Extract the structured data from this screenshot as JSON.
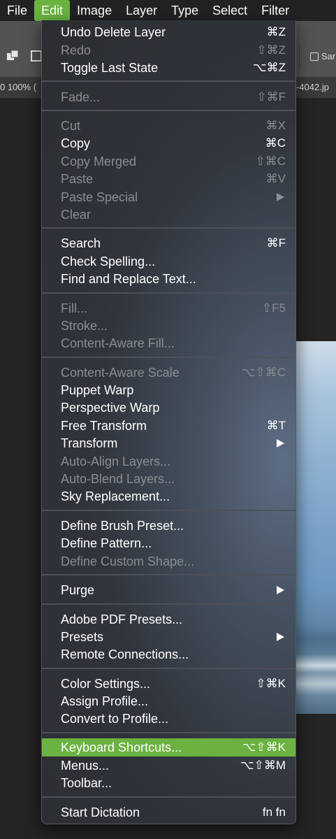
{
  "menubar": {
    "items": [
      {
        "label": "File",
        "active": false
      },
      {
        "label": "Edit",
        "active": true
      },
      {
        "label": "Image",
        "active": false
      },
      {
        "label": "Layer",
        "active": false
      },
      {
        "label": "Type",
        "active": false
      },
      {
        "label": "Select",
        "active": false
      },
      {
        "label": "Filter",
        "active": false
      }
    ]
  },
  "options_bar": {
    "checkbox_label": "Sar"
  },
  "document_tab": {
    "zoom_text": "0 100% (",
    "filename_text": "-4042.jp"
  },
  "accent_color": "#6bb240",
  "edit_menu": {
    "items": [
      {
        "label": "Undo Delete Layer",
        "shortcut": "⌘Z",
        "enabled": true
      },
      {
        "label": "Redo",
        "shortcut": "⇧⌘Z",
        "enabled": false
      },
      {
        "label": "Toggle Last State",
        "shortcut": "⌥⌘Z",
        "enabled": true
      },
      {
        "label": "Fade...",
        "shortcut": "⇧⌘F",
        "enabled": false
      },
      {
        "label": "Cut",
        "shortcut": "⌘X",
        "enabled": false
      },
      {
        "label": "Copy",
        "shortcut": "⌘C",
        "enabled": true
      },
      {
        "label": "Copy Merged",
        "shortcut": "⇧⌘C",
        "enabled": false
      },
      {
        "label": "Paste",
        "shortcut": "⌘V",
        "enabled": false
      },
      {
        "label": "Paste Special",
        "shortcut": "",
        "submenu": true,
        "enabled": false
      },
      {
        "label": "Clear",
        "shortcut": "",
        "enabled": false
      },
      {
        "label": "Search",
        "shortcut": "⌘F",
        "enabled": true
      },
      {
        "label": "Check Spelling...",
        "shortcut": "",
        "enabled": true
      },
      {
        "label": "Find and Replace Text...",
        "shortcut": "",
        "enabled": true
      },
      {
        "label": "Fill...",
        "shortcut": "⇧F5",
        "enabled": false
      },
      {
        "label": "Stroke...",
        "shortcut": "",
        "enabled": false
      },
      {
        "label": "Content-Aware Fill...",
        "shortcut": "",
        "enabled": false
      },
      {
        "label": "Content-Aware Scale",
        "shortcut": "⌥⇧⌘C",
        "enabled": false
      },
      {
        "label": "Puppet Warp",
        "shortcut": "",
        "enabled": true
      },
      {
        "label": "Perspective Warp",
        "shortcut": "",
        "enabled": true
      },
      {
        "label": "Free Transform",
        "shortcut": "⌘T",
        "enabled": true
      },
      {
        "label": "Transform",
        "shortcut": "",
        "submenu": true,
        "enabled": true
      },
      {
        "label": "Auto-Align Layers...",
        "shortcut": "",
        "enabled": false
      },
      {
        "label": "Auto-Blend Layers...",
        "shortcut": "",
        "enabled": false
      },
      {
        "label": "Sky Replacement...",
        "shortcut": "",
        "enabled": true
      },
      {
        "label": "Define Brush Preset...",
        "shortcut": "",
        "enabled": true
      },
      {
        "label": "Define Pattern...",
        "shortcut": "",
        "enabled": true
      },
      {
        "label": "Define Custom Shape...",
        "shortcut": "",
        "enabled": false
      },
      {
        "label": "Purge",
        "shortcut": "",
        "submenu": true,
        "enabled": true
      },
      {
        "label": "Adobe PDF Presets...",
        "shortcut": "",
        "enabled": true
      },
      {
        "label": "Presets",
        "shortcut": "",
        "submenu": true,
        "enabled": true
      },
      {
        "label": "Remote Connections...",
        "shortcut": "",
        "enabled": true
      },
      {
        "label": "Color Settings...",
        "shortcut": "⇧⌘K",
        "enabled": true
      },
      {
        "label": "Assign Profile...",
        "shortcut": "",
        "enabled": true
      },
      {
        "label": "Convert to Profile...",
        "shortcut": "",
        "enabled": true
      },
      {
        "label": "Keyboard Shortcuts...",
        "shortcut": "⌥⇧⌘K",
        "enabled": true,
        "highlighted": true
      },
      {
        "label": "Menus...",
        "shortcut": "⌥⇧⌘M",
        "enabled": true
      },
      {
        "label": "Toolbar...",
        "shortcut": "",
        "enabled": true
      },
      {
        "label": "Start Dictation",
        "shortcut": "fn fn",
        "enabled": true
      }
    ]
  }
}
